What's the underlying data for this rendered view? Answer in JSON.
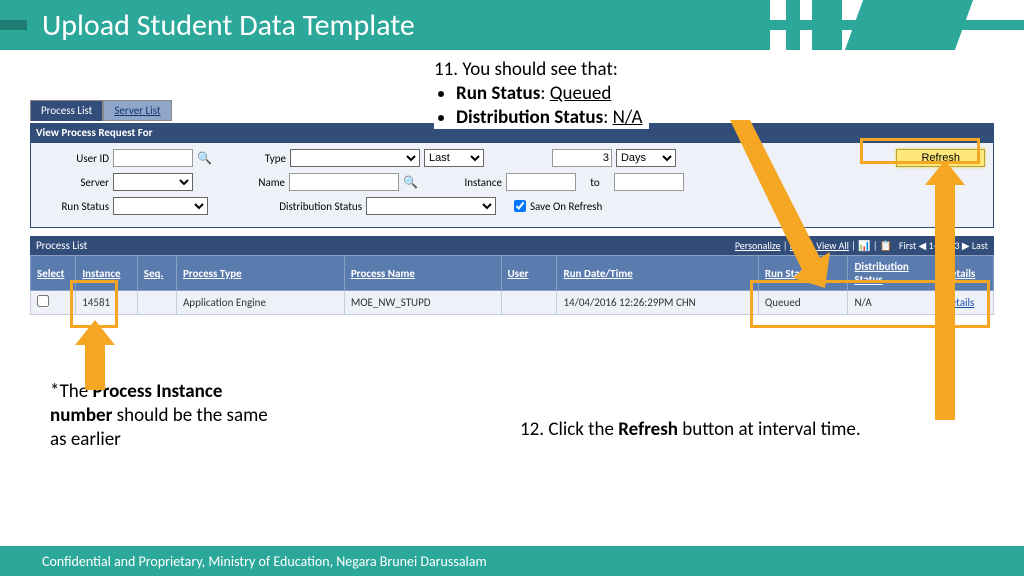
{
  "slide": {
    "title": "Upload Student Data Template",
    "footer": "Confidential and Proprietary, Ministry of Education, Negara Brunei Darussalam"
  },
  "tabs": {
    "process_list": "Process List",
    "server_list": "Server List"
  },
  "panel": {
    "view_hdr": "View Process Request For",
    "labels": {
      "user_id": "User ID",
      "type": "Type",
      "last": "Last",
      "days_val": "3",
      "days": "Days",
      "server": "Server",
      "name": "Name",
      "instance": "Instance",
      "to": "to",
      "run_status": "Run Status",
      "dist_status": "Distribution Status",
      "save": "Save On Refresh",
      "refresh": "Refresh"
    }
  },
  "list": {
    "hdr": "Process List",
    "tools": {
      "personalize": "Personalize",
      "find": "Find",
      "view_all": "View All",
      "paging": "1-3 of 3",
      "first": "First",
      "last": "Last"
    },
    "cols": {
      "select": "Select",
      "instance": "Instance",
      "seq": "Seq.",
      "ptype": "Process Type",
      "pname": "Process Name",
      "user": "User",
      "rundt": "Run Date/Time",
      "runst": "Run Status",
      "distst": "Distribution Status",
      "details": "Details"
    },
    "row": {
      "instance": "14581",
      "ptype": "Application Engine",
      "pname": "MOE_NW_STUPD",
      "user": "",
      "rundt": "14/04/2016 12:26:29PM CHN",
      "runst": "Queued",
      "distst": "N/A",
      "details": "Details"
    }
  },
  "notes": {
    "step11_lead": "11. You should see that:",
    "step11_a_label": "Run Status",
    "step11_a_val": "Queued",
    "step11_b_label": "Distribution Status",
    "step11_b_val": "N/A",
    "step12_pre": "12. Click the ",
    "step12_bold": "Refresh",
    "step12_post": " button at interval time.",
    "instnote_pre": "*The ",
    "instnote_bold": "Process Instance number",
    "instnote_post": " should be the same as earlier"
  }
}
